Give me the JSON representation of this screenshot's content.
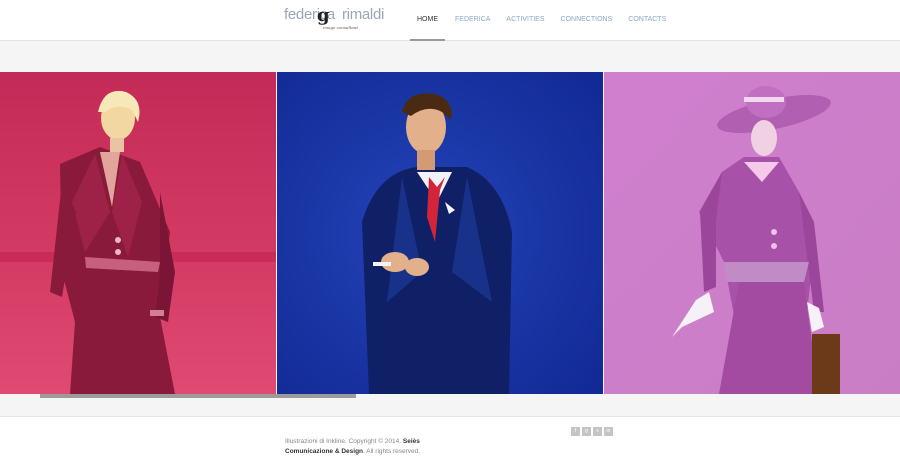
{
  "brand": {
    "logo_left": "federica",
    "logo_mark": "g",
    "logo_right": "rimaldi",
    "tagline": "image consultant"
  },
  "nav": {
    "items": [
      {
        "label": "HOME",
        "active": true
      },
      {
        "label": "FEDERICA",
        "active": false
      },
      {
        "label": "ACTIVITIES",
        "active": false
      },
      {
        "label": "CONNECTIONS",
        "active": false
      },
      {
        "label": "CONTACTS",
        "active": false
      }
    ]
  },
  "gallery": {
    "slides": [
      {
        "subject": "woman in red suit",
        "background": "#d12d5a"
      },
      {
        "subject": "man in blue suit with red tie",
        "background": "#1a33a8"
      },
      {
        "subject": "woman in pink hat and dress",
        "background": "#cf7fca"
      }
    ],
    "scroll_position": 0.385
  },
  "footer": {
    "credit_part1": "Illustrazioni di Inkline. Copyright © 2014.",
    "credit_company": "Seiès Comunicazione & Design",
    "credit_part2": ". All rights reserved."
  },
  "social": {
    "icons": [
      "facebook-icon",
      "google-plus-icon",
      "skype-icon",
      "linkedin-icon"
    ],
    "glyphs": [
      "f",
      "g",
      "s",
      "in"
    ]
  },
  "colors": {
    "nav_link": "#8fa7c7",
    "nav_active": "#333333",
    "scrollbar": "#9b9b9b"
  }
}
